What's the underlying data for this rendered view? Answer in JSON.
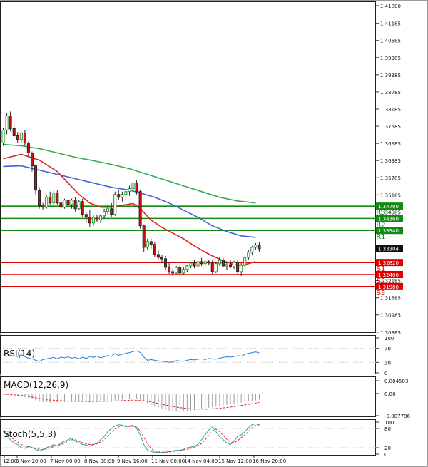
{
  "chart_data": {
    "type": "candlestick",
    "main": {
      "y_ticks": [
        "1.41800",
        "1.41185",
        "1.40585",
        "1.39985",
        "1.39385",
        "1.38785",
        "1.38185",
        "1.37585",
        "1.36985",
        "1.36385",
        "1.35785",
        "1.35185",
        "1.34585",
        "1.33985",
        "1.33385",
        "1.32785",
        "1.32185",
        "1.31585",
        "1.30985",
        "1.30385"
      ],
      "ylim": [
        1.3038,
        1.4185
      ],
      "price_tags": [
        {
          "value": 1.3479,
          "label": "1.34790",
          "color": "#138a16"
        },
        {
          "value": 1.3436,
          "label": "1.34360",
          "color": "#138a16"
        },
        {
          "value": 1.3394,
          "label": "1.33940",
          "color": "#138a16"
        },
        {
          "value": 1.33304,
          "label": "1.33304",
          "color": "#111111"
        },
        {
          "value": 1.3282,
          "label": "1.32820",
          "color": "#e00000"
        },
        {
          "value": 1.324,
          "label": "1.32400",
          "color": "#e00000"
        },
        {
          "value": 1.3198,
          "label": "1.31980",
          "color": "#e00000"
        }
      ],
      "levels": [
        {
          "name": "R3",
          "value": 1.3479,
          "color": "#138a16"
        },
        {
          "name": "R2",
          "value": 1.3436,
          "color": "#138a16"
        },
        {
          "name": "R1",
          "value": 1.3394,
          "color": "#138a16"
        },
        {
          "name": "S1",
          "value": 1.3282,
          "color": "#e00000"
        },
        {
          "name": "S2",
          "value": 1.324,
          "color": "#e00000"
        },
        {
          "name": "S3",
          "value": 1.3198,
          "color": "#e00000"
        }
      ],
      "candles": [
        [
          1.37,
          1.3752,
          1.369,
          1.3745
        ],
        [
          1.3745,
          1.3805,
          1.373,
          1.3795
        ],
        [
          1.3795,
          1.381,
          1.374,
          1.375
        ],
        [
          1.375,
          1.3765,
          1.3715,
          1.3725
        ],
        [
          1.3725,
          1.3738,
          1.37,
          1.3712
        ],
        [
          1.3712,
          1.374,
          1.37,
          1.3735
        ],
        [
          1.3735,
          1.3745,
          1.369,
          1.37
        ],
        [
          1.37,
          1.3705,
          1.365,
          1.3665
        ],
        [
          1.3665,
          1.367,
          1.36,
          1.362
        ],
        [
          1.362,
          1.3625,
          1.352,
          1.3535
        ],
        [
          1.3535,
          1.3545,
          1.347,
          1.348
        ],
        [
          1.348,
          1.349,
          1.3465,
          1.3475
        ],
        [
          1.3475,
          1.352,
          1.347,
          1.351
        ],
        [
          1.351,
          1.353,
          1.3485,
          1.349
        ],
        [
          1.349,
          1.3535,
          1.348,
          1.3525
        ],
        [
          1.3525,
          1.3535,
          1.3485,
          1.349
        ],
        [
          1.349,
          1.35,
          1.346,
          1.3475
        ],
        [
          1.3475,
          1.3505,
          1.347,
          1.35
        ],
        [
          1.35,
          1.3515,
          1.348,
          1.3485
        ],
        [
          1.3485,
          1.3505,
          1.347,
          1.35
        ],
        [
          1.35,
          1.351,
          1.346,
          1.347
        ],
        [
          1.347,
          1.35,
          1.3465,
          1.3495
        ],
        [
          1.3495,
          1.3505,
          1.344,
          1.345
        ],
        [
          1.345,
          1.346,
          1.342,
          1.344
        ],
        [
          1.344,
          1.3465,
          1.3405,
          1.342
        ],
        [
          1.342,
          1.345,
          1.341,
          1.344
        ],
        [
          1.344,
          1.345,
          1.3425,
          1.343
        ],
        [
          1.343,
          1.345,
          1.342,
          1.3445
        ],
        [
          1.3445,
          1.347,
          1.3435,
          1.346
        ],
        [
          1.346,
          1.3485,
          1.345,
          1.347
        ],
        [
          1.347,
          1.349,
          1.344,
          1.345
        ],
        [
          1.345,
          1.353,
          1.3445,
          1.352
        ],
        [
          1.352,
          1.3535,
          1.35,
          1.351
        ],
        [
          1.351,
          1.353,
          1.3495,
          1.352
        ],
        [
          1.352,
          1.354,
          1.35,
          1.353
        ],
        [
          1.353,
          1.355,
          1.3515,
          1.354
        ],
        [
          1.354,
          1.3565,
          1.353,
          1.356
        ],
        [
          1.356,
          1.357,
          1.352,
          1.353
        ],
        [
          1.353,
          1.3535,
          1.34,
          1.341
        ],
        [
          1.341,
          1.3415,
          1.332,
          1.3335
        ],
        [
          1.3335,
          1.3365,
          1.3325,
          1.3355
        ],
        [
          1.3355,
          1.3365,
          1.333,
          1.3345
        ],
        [
          1.3345,
          1.3352,
          1.33,
          1.331
        ],
        [
          1.331,
          1.3325,
          1.329,
          1.33
        ],
        [
          1.33,
          1.331,
          1.328,
          1.3295
        ],
        [
          1.3295,
          1.3305,
          1.3255,
          1.3265
        ],
        [
          1.3265,
          1.328,
          1.324,
          1.325
        ],
        [
          1.325,
          1.326,
          1.3235,
          1.3245
        ],
        [
          1.3245,
          1.327,
          1.324,
          1.3265
        ],
        [
          1.3265,
          1.3275,
          1.3235,
          1.3245
        ],
        [
          1.3245,
          1.3265,
          1.3238,
          1.3258
        ],
        [
          1.3258,
          1.3275,
          1.325,
          1.327
        ],
        [
          1.327,
          1.3285,
          1.3262,
          1.328
        ],
        [
          1.328,
          1.329,
          1.3262,
          1.327
        ],
        [
          1.327,
          1.3288,
          1.3262,
          1.3285
        ],
        [
          1.3285,
          1.3298,
          1.327,
          1.3278
        ],
        [
          1.3278,
          1.329,
          1.3268,
          1.3285
        ],
        [
          1.3285,
          1.3292,
          1.3272,
          1.328
        ],
        [
          1.328,
          1.329,
          1.324,
          1.325
        ],
        [
          1.325,
          1.3282,
          1.3245,
          1.3278
        ],
        [
          1.3278,
          1.33,
          1.327,
          1.329
        ],
        [
          1.329,
          1.3298,
          1.3265,
          1.327
        ],
        [
          1.327,
          1.3285,
          1.3255,
          1.3275
        ],
        [
          1.3275,
          1.329,
          1.3262,
          1.3268
        ],
        [
          1.3268,
          1.3288,
          1.326,
          1.3282
        ],
        [
          1.3282,
          1.329,
          1.324,
          1.325
        ],
        [
          1.325,
          1.328,
          1.3235,
          1.3272
        ],
        [
          1.3272,
          1.3305,
          1.3265,
          1.33
        ],
        [
          1.33,
          1.3325,
          1.329,
          1.3318
        ],
        [
          1.3318,
          1.334,
          1.331,
          1.3335
        ],
        [
          1.3335,
          1.335,
          1.3325,
          1.3343
        ],
        [
          1.3343,
          1.3352,
          1.332,
          1.333
        ]
      ],
      "ma_red": [
        [
          0,
          1.3645
        ],
        [
          5,
          1.366
        ],
        [
          10,
          1.364
        ],
        [
          15,
          1.36
        ],
        [
          18,
          1.356
        ],
        [
          21,
          1.352
        ],
        [
          24,
          1.349
        ],
        [
          27,
          1.3475
        ],
        [
          30,
          1.3475
        ],
        [
          33,
          1.3482
        ],
        [
          36,
          1.3488
        ],
        [
          38,
          1.347
        ],
        [
          41,
          1.343
        ],
        [
          44,
          1.3405
        ],
        [
          47,
          1.3385
        ],
        [
          50,
          1.3365
        ],
        [
          53,
          1.334
        ],
        [
          56,
          1.3318
        ],
        [
          58,
          1.3305
        ],
        [
          61,
          1.3288
        ],
        [
          64,
          1.3275
        ],
        [
          66,
          1.3272
        ],
        [
          68,
          1.3278
        ],
        [
          70,
          1.3285
        ]
      ],
      "ma_blue": [
        [
          0,
          1.3618
        ],
        [
          5,
          1.362
        ],
        [
          10,
          1.3605
        ],
        [
          15,
          1.359
        ],
        [
          20,
          1.3575
        ],
        [
          25,
          1.356
        ],
        [
          30,
          1.3545
        ],
        [
          35,
          1.3535
        ],
        [
          38,
          1.3525
        ],
        [
          42,
          1.351
        ],
        [
          46,
          1.349
        ],
        [
          50,
          1.3465
        ],
        [
          54,
          1.344
        ],
        [
          58,
          1.341
        ],
        [
          62,
          1.339
        ],
        [
          66,
          1.3375
        ],
        [
          70,
          1.337
        ]
      ],
      "ma_green": [
        [
          0,
          1.3695
        ],
        [
          5,
          1.369
        ],
        [
          10,
          1.368
        ],
        [
          15,
          1.3665
        ],
        [
          20,
          1.365
        ],
        [
          25,
          1.3638
        ],
        [
          30,
          1.3625
        ],
        [
          35,
          1.361
        ],
        [
          40,
          1.359
        ],
        [
          45,
          1.357
        ],
        [
          50,
          1.355
        ],
        [
          55,
          1.353
        ],
        [
          60,
          1.351
        ],
        [
          65,
          1.3497
        ],
        [
          70,
          1.349
        ]
      ]
    },
    "rsi": {
      "label": "RSI(14)",
      "y_ticks": [
        "100",
        "70",
        "30",
        "0"
      ],
      "ylim": [
        0,
        100
      ],
      "values": [
        52,
        55,
        50,
        48,
        47,
        52,
        46,
        42,
        40,
        36,
        33,
        38,
        40,
        42,
        44,
        40,
        45,
        43,
        46,
        42,
        44,
        40,
        45,
        41,
        47,
        44,
        48,
        43,
        46,
        50,
        47,
        55,
        50,
        53,
        56,
        58,
        61,
        63,
        58,
        45,
        36,
        38,
        36,
        34,
        33,
        32,
        30,
        31,
        35,
        34,
        33,
        36,
        38,
        37,
        39,
        40,
        38,
        41,
        40,
        39,
        42,
        44,
        46,
        45,
        47,
        49,
        48,
        53,
        56,
        58,
        60,
        57
      ]
    },
    "macd": {
      "label": "MACD(12,26,9)",
      "y_ticks": [
        "0.004503",
        "0.00",
        "-0.007786"
      ],
      "ylim": [
        -0.007786,
        0.004503
      ],
      "hist": [
        -0.0002,
        -0.0004,
        -0.0006,
        -0.0008,
        -0.001,
        -0.0012,
        -0.0014,
        -0.0017,
        -0.002,
        -0.0024,
        -0.0028,
        -0.003,
        -0.0031,
        -0.0032,
        -0.0032,
        -0.0031,
        -0.003,
        -0.003,
        -0.0029,
        -0.0029,
        -0.0028,
        -0.0028,
        -0.0028,
        -0.0029,
        -0.0029,
        -0.0029,
        -0.0029,
        -0.0028,
        -0.0027,
        -0.0026,
        -0.0025,
        -0.0024,
        -0.0023,
        -0.0022,
        -0.0021,
        -0.002,
        -0.0019,
        -0.0019,
        -0.0022,
        -0.0028,
        -0.0034,
        -0.004,
        -0.0045,
        -0.005,
        -0.0055,
        -0.0058,
        -0.0061,
        -0.0063,
        -0.0064,
        -0.0064,
        -0.0063,
        -0.0062,
        -0.006,
        -0.0058,
        -0.0056,
        -0.0054,
        -0.0052,
        -0.005,
        -0.0048,
        -0.0046,
        -0.0044,
        -0.0042,
        -0.004,
        -0.0038,
        -0.0036,
        -0.0034,
        -0.0032,
        -0.003,
        -0.0028,
        -0.0026,
        -0.0024,
        -0.0022
      ],
      "signal": [
        [
          0,
          -0.0002
        ],
        [
          6,
          -0.0008
        ],
        [
          12,
          -0.0022
        ],
        [
          18,
          -0.0027
        ],
        [
          24,
          -0.0028
        ],
        [
          30,
          -0.0027
        ],
        [
          36,
          -0.0023
        ],
        [
          40,
          -0.0027
        ],
        [
          44,
          -0.0038
        ],
        [
          48,
          -0.0048
        ],
        [
          52,
          -0.0054
        ],
        [
          56,
          -0.0055
        ],
        [
          60,
          -0.0052
        ],
        [
          64,
          -0.0046
        ],
        [
          68,
          -0.0038
        ],
        [
          71,
          -0.0031
        ]
      ]
    },
    "stoch": {
      "label": "Stoch(5,5,3)",
      "y_ticks": [
        "100",
        "80",
        "20",
        "0"
      ],
      "ylim": [
        0,
        100
      ],
      "k": [
        75,
        60,
        45,
        35,
        30,
        20,
        18,
        25,
        20,
        15,
        10,
        15,
        20,
        25,
        30,
        25,
        35,
        40,
        45,
        50,
        40,
        35,
        30,
        28,
        25,
        30,
        35,
        45,
        55,
        70,
        80,
        88,
        92,
        90,
        85,
        88,
        90,
        80,
        60,
        30,
        12,
        8,
        6,
        5,
        5,
        6,
        8,
        10,
        12,
        12,
        15,
        20,
        22,
        25,
        30,
        45,
        60,
        75,
        85,
        70,
        55,
        45,
        35,
        30,
        40,
        55,
        60,
        70,
        82,
        92,
        95,
        90
      ],
      "d": [
        70,
        65,
        55,
        45,
        38,
        30,
        25,
        22,
        20,
        18,
        15,
        14,
        16,
        20,
        24,
        27,
        30,
        34,
        40,
        45,
        45,
        40,
        36,
        32,
        30,
        30,
        32,
        38,
        46,
        56,
        68,
        78,
        86,
        90,
        88,
        86,
        87,
        84,
        72,
        52,
        32,
        18,
        10,
        7,
        6,
        6,
        7,
        8,
        10,
        11,
        13,
        15,
        18,
        22,
        26,
        33,
        45,
        58,
        72,
        78,
        70,
        58,
        46,
        38,
        36,
        42,
        52,
        60,
        70,
        82,
        90,
        92
      ]
    },
    "x_ticks": [
      "12:00",
      "3 Nov 20:00",
      "7 Nov 00:00",
      "8 Nov 08:00",
      "9 Nov 16:00",
      "11 Nov 00:00",
      "14 Nov 04:00",
      "15 Nov 12:00",
      "16 Nov 20:00"
    ]
  }
}
